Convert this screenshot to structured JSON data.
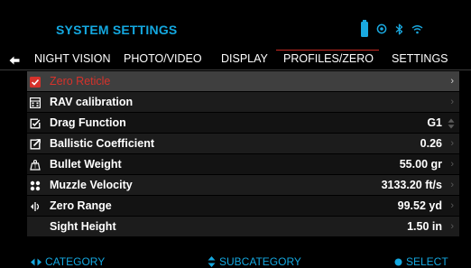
{
  "header": {
    "title": "SYSTEM SETTINGS"
  },
  "status_icons": [
    "battery-icon",
    "recording-icon",
    "bluetooth-icon",
    "wifi-icon"
  ],
  "tabs": [
    {
      "label": "NIGHT VISION",
      "active": false
    },
    {
      "label": "PHOTO/VIDEO",
      "active": false
    },
    {
      "label": "DISPLAY",
      "active": false
    },
    {
      "label": "PROFILES/ZERO",
      "active": true
    },
    {
      "label": "SETTINGS",
      "active": false
    }
  ],
  "rows": [
    {
      "icon": "checkbox-checked-icon",
      "label": "Zero Reticle",
      "value": "",
      "control": "chevron",
      "selected": true
    },
    {
      "icon": "calculator-icon",
      "label": "RAV calibration",
      "value": "",
      "control": "chevron"
    },
    {
      "icon": "edit-square-icon",
      "label": "Drag Function",
      "value": "G1",
      "control": "updown"
    },
    {
      "icon": "external-edit-icon",
      "label": "Ballistic Coefficient",
      "value": "0.26",
      "control": "chevron"
    },
    {
      "icon": "weight-icon",
      "label": "Bullet Weight",
      "value": "55.00 gr",
      "control": "chevron"
    },
    {
      "icon": "dots-grid-icon",
      "label": "Muzzle Velocity",
      "value": "3133.20 ft/s",
      "control": "chevron"
    },
    {
      "icon": "target-range-icon",
      "label": "Zero Range",
      "value": "99.52 yd",
      "control": "chevron"
    },
    {
      "icon": "",
      "label": "Sight Height",
      "value": "1.50 in",
      "control": "chevron"
    }
  ],
  "footer": {
    "category": "CATEGORY",
    "subcategory": "SUBCATEGORY",
    "select": "SELECT"
  },
  "colors": {
    "accent": "#14a8e0",
    "selected_text": "#d6322b",
    "tab_underline": "#c82a22"
  }
}
